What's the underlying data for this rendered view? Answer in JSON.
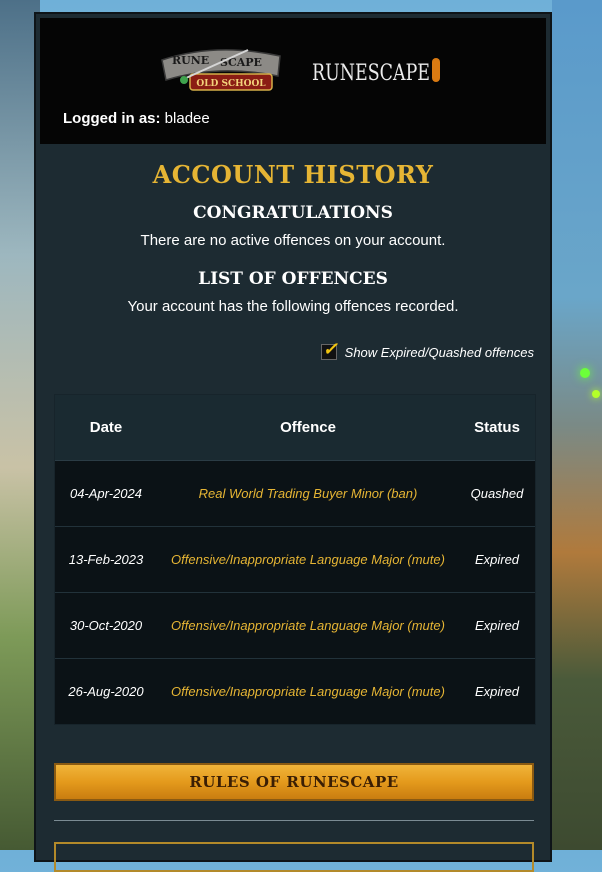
{
  "header": {
    "osrs_logo_text": [
      "RUNE",
      "SCAPE",
      "OLD SCHOOL"
    ],
    "rs_logo_text": "RUNESCAPE",
    "logged_in_label": "Logged in as:",
    "username": "bladee"
  },
  "page": {
    "title": "ACCOUNT HISTORY",
    "congrats_heading": "CONGRATULATIONS",
    "congrats_text": "There are no active offences on your account.",
    "list_heading": "LIST OF OFFENCES",
    "list_text": "Your account has the following offences recorded."
  },
  "toggle": {
    "label": "Show Expired/Quashed offences",
    "checked": true
  },
  "table": {
    "headers": [
      "Date",
      "Offence",
      "Status"
    ],
    "rows": [
      {
        "date": "04-Apr-2024",
        "offence": "Real World Trading Buyer Minor (ban)",
        "status": "Quashed"
      },
      {
        "date": "13-Feb-2023",
        "offence": "Offensive/Inappropriate Language Major (mute)",
        "status": "Expired"
      },
      {
        "date": "30-Oct-2020",
        "offence": "Offensive/Inappropriate Language Major (mute)",
        "status": "Expired"
      },
      {
        "date": "26-Aug-2020",
        "offence": "Offensive/Inappropriate Language Major (mute)",
        "status": "Expired"
      }
    ]
  },
  "buttons": {
    "rules_label": "RULES OF RUNESCAPE"
  },
  "colors": {
    "accent_gold": "#e6b534",
    "panel_bg": "#1d2b32",
    "table_bg": "#0b1216",
    "button_orange": "#e49a1c"
  },
  "icons": {
    "checkbox": "check-icon"
  }
}
